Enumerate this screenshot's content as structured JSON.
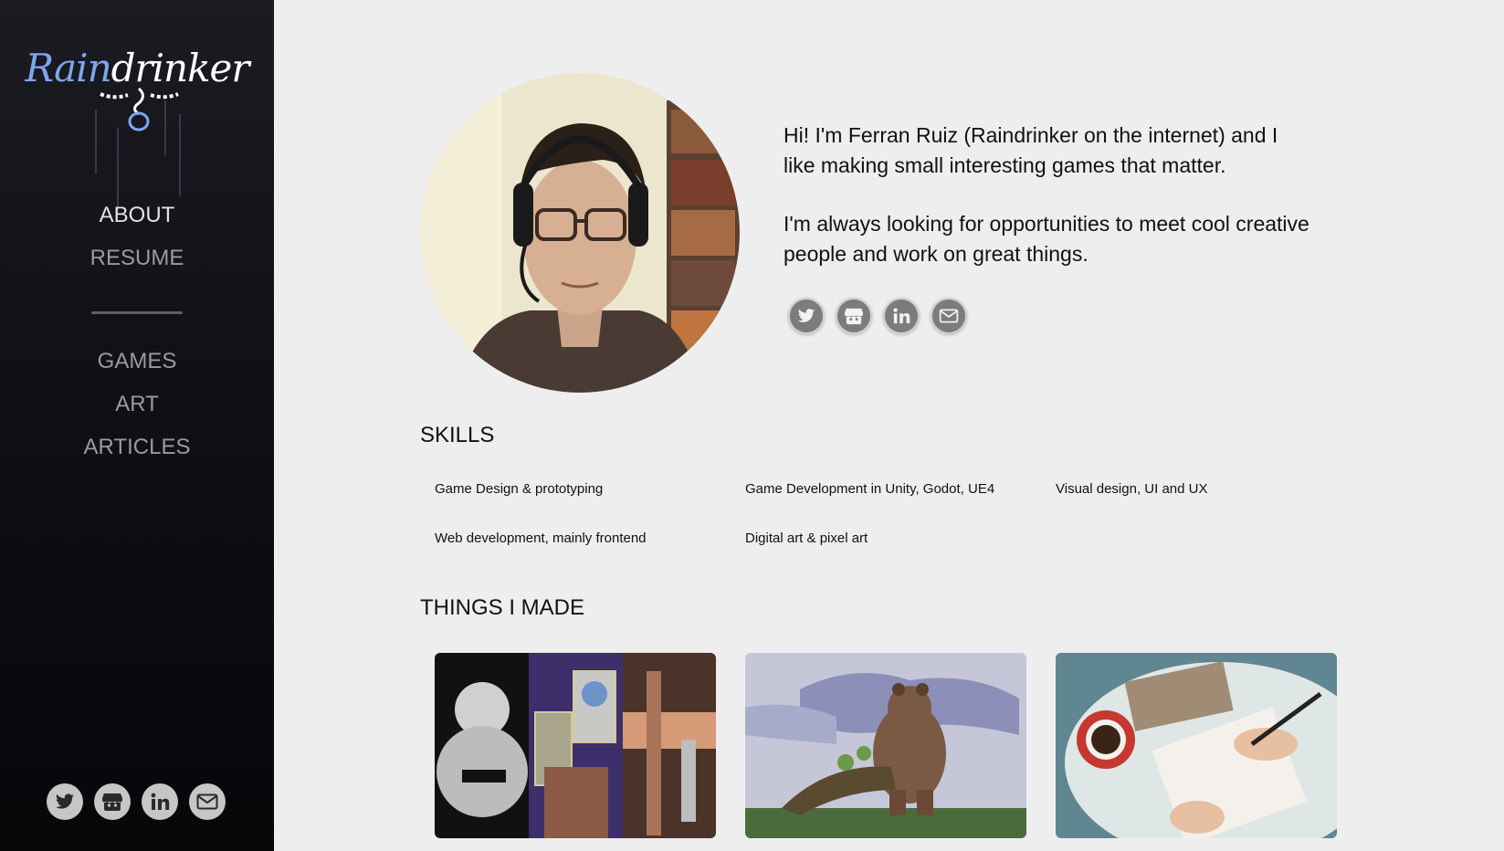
{
  "sidebar": {
    "logo": {
      "part1": "Rain",
      "part2": "drinker"
    },
    "nav_primary": [
      "ABOUT",
      "RESUME"
    ],
    "nav_secondary": [
      "GAMES",
      "ART",
      "ARTICLES"
    ],
    "social_icons": [
      "twitter-icon",
      "itchio-icon",
      "linkedin-icon",
      "mail-icon"
    ]
  },
  "main": {
    "bio": {
      "p1": "Hi! I'm Ferran Ruiz (Raindrinker on the internet) and I like making small interesting games that matter.",
      "p2": "I'm always looking for opportunities to meet cool creative people and work on great things."
    },
    "social_icons": [
      "twitter-icon",
      "itchio-icon",
      "linkedin-icon",
      "mail-icon"
    ],
    "skills_title": "SKILLS",
    "skills": [
      "Game Design & prototyping",
      "Game Development in Unity, Godot, UE4",
      "Visual design, UI and UX",
      "Web development, mainly frontend",
      "Digital art & pixel art"
    ],
    "things_title": "THINGS I MADE",
    "cards": [
      "games-card-thumbnail",
      "art-card-thumbnail",
      "articles-card-thumbnail"
    ]
  },
  "colors": {
    "sidebar_bg": "#101015",
    "page_bg": "#eeeeee",
    "logo_blue": "#7ea6ee",
    "nav_active": "#e3e3e6",
    "nav_inactive": "#9a9a9f"
  }
}
